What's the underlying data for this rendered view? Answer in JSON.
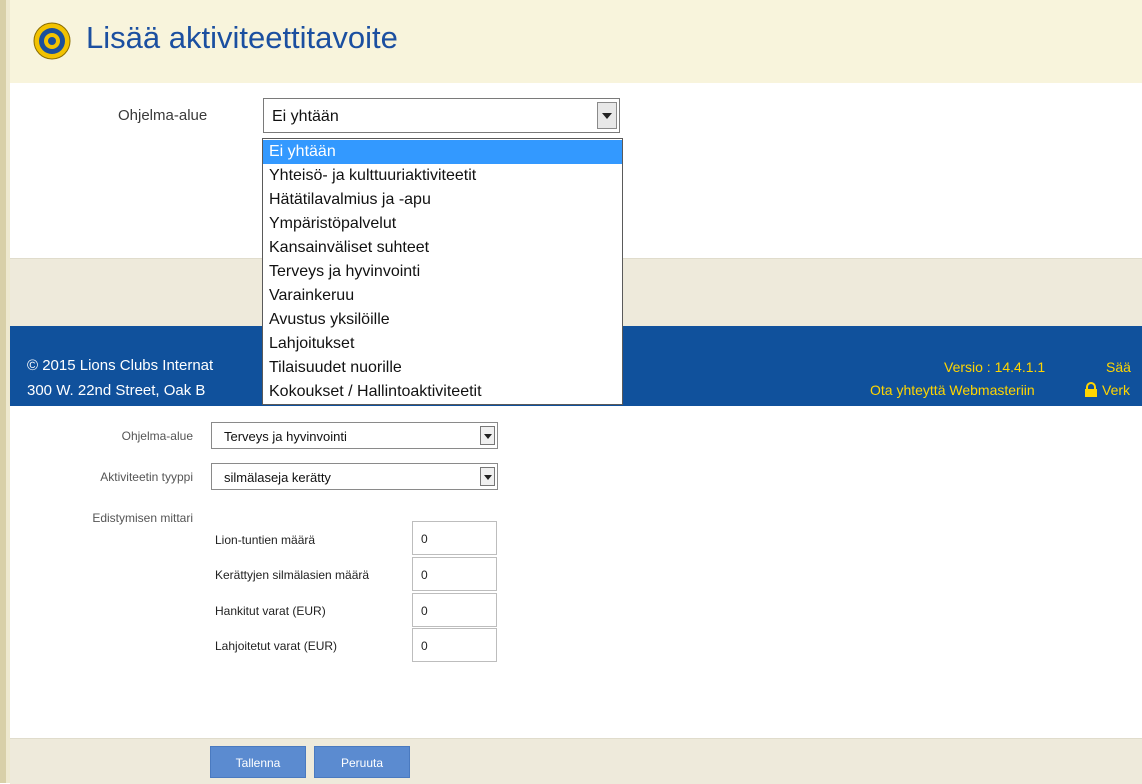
{
  "page": {
    "title": "Lisää aktiviteettitavoite"
  },
  "top_form": {
    "program_label": "Ohjelma-alue",
    "program_value": "Ei yhtään",
    "dropdown_options": [
      "Ei yhtään",
      "Yhteisö- ja kulttuuriaktiviteetit",
      "Hätätilavalmius ja -apu",
      "Ympäristöpalvelut",
      "Kansainväliset suhteet",
      "Terveys ja hyvinvointi",
      "Varainkeruu",
      "Avustus yksilöille",
      "Lahjoitukset",
      "Tilaisuudet nuorille",
      "Kokoukset / Hallintoaktiviteetit"
    ]
  },
  "footer": {
    "copyright": "© 2015 Lions Clubs Internat",
    "address": "300 W. 22nd Street, Oak B",
    "version": "Versio : 14.4.1.1",
    "terms": "Sää",
    "contact": "Ota yhteyttä Webmasteriin",
    "secure": "Verk"
  },
  "bottom_form": {
    "program_label": "Ohjelma-alue",
    "program_value": "Terveys ja hyvinvointi",
    "type_label": "Aktiviteetin tyyppi",
    "type_value": "silmälaseja kerätty",
    "metrics_label": "Edistymisen mittari",
    "metrics": [
      {
        "label": "Lion-tuntien määrä",
        "value": "0"
      },
      {
        "label": "Kerättyjen silmälasien määrä",
        "value": "0"
      },
      {
        "label": "Hankitut varat (EUR)",
        "value": "0"
      },
      {
        "label": "Lahjoitetut varat (EUR)",
        "value": "0"
      }
    ]
  },
  "actions": {
    "save": "Tallenna",
    "cancel": "Peruuta"
  },
  "colors": {
    "title_blue": "#1b4fa0",
    "footer_blue": "#10519c",
    "footer_yellow": "#ffd500",
    "dropdown_selected": "#3399ff",
    "button_blue": "#5b8bd0"
  }
}
